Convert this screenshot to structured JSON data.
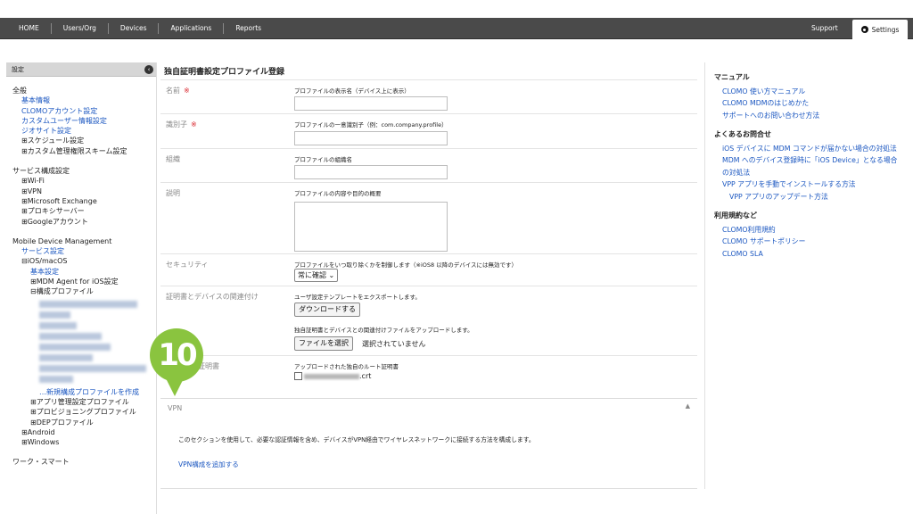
{
  "topnav": {
    "items": [
      "HOME",
      "Users/Org",
      "Devices",
      "Applications",
      "Reports"
    ],
    "support": "Support",
    "settings": "Settings"
  },
  "sidebar": {
    "header": "設定",
    "collapse_glyph": "‹",
    "general": {
      "title": "全般",
      "links": [
        "基本情報",
        "CLOMOアカウント設定",
        "カスタムユーザー情報設定",
        "ジオサイト設定"
      ],
      "items": [
        "⊞スケジュール設定",
        "⊞カスタム管理権限スキーム設定"
      ]
    },
    "service": {
      "title": "サービス構成設定",
      "items": [
        "⊞Wi-Fi",
        "⊞VPN",
        "⊞Microsoft Exchange",
        "⊞プロキシサーバー",
        "⊞Googleアカウント"
      ]
    },
    "mdm": {
      "title": "Mobile Device Management",
      "service_link": "サービス設定",
      "ios": "⊟iOS/macOS",
      "basic_link": "基本設定",
      "agent": "⊞MDM Agent for iOS設定",
      "profiles": "⊟構成プロファイル",
      "new_profile": "…新規構成プロファイルを作成",
      "after": [
        "⊞アプリ管理設定プロファイル",
        "⊞プロビジョニングプロファイル",
        "⊞DEPプロファイル"
      ],
      "android": "⊞Android",
      "windows": "⊞Windows"
    },
    "bottom": "ワーク・スマート"
  },
  "main": {
    "title": "独自証明書設定プロファイル登録",
    "name_label": "名前",
    "name_desc": "プロファイルの表示名（デバイス上に表示）",
    "id_label": "識別子",
    "id_desc": "プロファイルの一意識別子（例：com.company.profile）",
    "org_label": "組織",
    "org_desc": "プロファイルの組織名",
    "desc_label": "説明",
    "desc_desc": "プロファイルの内容や目的の概要",
    "security_label": "セキュリティ",
    "security_desc": "プロファイルをいつ取り除くかを制御します（※iOS8 以降のデバイスには無効です）",
    "security_value": "常に確認",
    "assoc_label": "証明書とデバイスの関連付け",
    "assoc_desc1": "ユーザ設定テンプレートをエクスポートします。",
    "download_btn": "ダウンロードする",
    "assoc_desc2": "独自証明書とデバイスとの関連付けファイルをアップロードします。",
    "file_btn": "ファイルを選択",
    "file_status": "選択されていません",
    "cert_label": "証明書",
    "cert_desc": "アップロードされた独自のルート証明書",
    "cert_file": ".crt",
    "required_mark": "※",
    "vpn": {
      "header": "VPN",
      "arrow": "▲",
      "desc": "このセクションを使用して、必要な認証情報を含め、デバイスがVPN経由でワイヤレスネットワークに接続する方法を構成します。",
      "link": "VPN構成を追加する"
    }
  },
  "badge": "10",
  "rpanel": {
    "manual_title": "マニュアル",
    "manual_links": [
      "CLOMO 使い方マニュアル",
      "CLOMO MDMのはじめかた",
      "サポートへのお問い合わせ方法"
    ],
    "faq_title": "よくあるお問合せ",
    "faq_links": [
      "iOS デバイスに MDM コマンドが届かない場合の対処法",
      "MDM へのデバイス登録時に「iOS Device」となる場合の対処法",
      "VPP アプリを手動でインストールする方法"
    ],
    "faq_sub": "VPP アプリのアップデート方法",
    "terms_title": "利用規約など",
    "terms_links": [
      "CLOMO利用規約",
      "CLOMO サポートポリシー",
      "CLOMO SLA"
    ]
  },
  "colors": {
    "topbar": "#4a4a4a",
    "link": "#1a56c0",
    "required": "#d9282f",
    "badge": "#8ac43f"
  }
}
